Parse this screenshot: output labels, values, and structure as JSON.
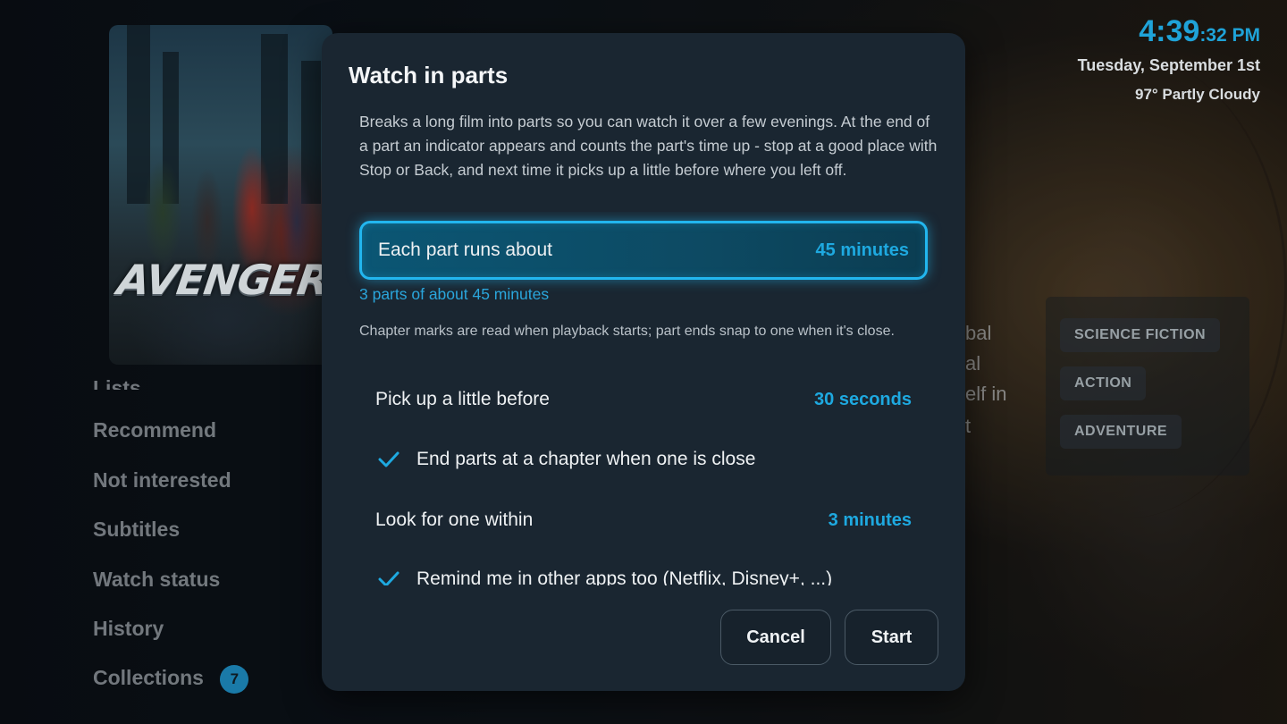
{
  "clock": {
    "time": "4:39",
    "seconds": ":32 PM",
    "date": "Tuesday, September 1st",
    "weather": "97° Partly Cloudy"
  },
  "poster": {
    "logo_text": "AVENGERS"
  },
  "side_menu": {
    "items": [
      {
        "label": "Lists"
      },
      {
        "label": "Recommend"
      },
      {
        "label": "Not interested"
      },
      {
        "label": "Subtitles"
      },
      {
        "label": "Watch status"
      },
      {
        "label": "History"
      },
      {
        "label": "Collections",
        "badge": "7"
      }
    ]
  },
  "synopsis_fragment": {
    "lines": [
      "bal",
      "al",
      "elf in",
      "t"
    ]
  },
  "genres": [
    "SCIENCE FICTION",
    "ACTION",
    "ADVENTURE"
  ],
  "dialog": {
    "title": "Watch in parts",
    "intro": "Breaks a long film into parts so you can watch it over a few evenings. At the end of a part an indicator appears and counts the part's time up - stop at a good place with Stop or Back, and next time it picks up a little before where you left off.",
    "part_length": {
      "label": "Each part runs about",
      "value": "45 minutes"
    },
    "parts_summary": "3 parts of about 45 minutes",
    "chapter_hint": "Chapter marks are read when playback starts; part ends snap to one when it's close.",
    "pickup": {
      "label": "Pick up a little before",
      "value": "30 seconds"
    },
    "end_at_chapter": {
      "label": "End parts at a chapter when one is close",
      "checked": true
    },
    "look_within": {
      "label": "Look for one within",
      "value": "3 minutes"
    },
    "remind_other_apps": {
      "label": "Remind me in other apps too (Netflix, Disney+, ...)",
      "checked": true
    },
    "cancel_label": "Cancel",
    "start_label": "Start"
  },
  "colors": {
    "accent": "#1ea9e0",
    "dialog_bg": "#1a2631",
    "focus_border": "#22b6ef"
  }
}
